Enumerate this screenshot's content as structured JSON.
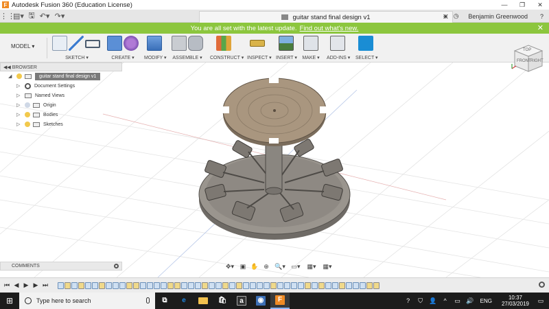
{
  "title_bar": {
    "app_icon": "F",
    "title": "Autodesk Fusion 360 (Education License)",
    "window_controls": [
      "—",
      "❐",
      "✕"
    ]
  },
  "tab_bar": {
    "quick_access": [
      "⋮⋮",
      "▤▾",
      "🖫",
      "↶▾",
      "↷▾"
    ],
    "document_tab": "guitar stand final design v1",
    "close": "✕",
    "right": {
      "new_tab": "+",
      "clock": "◷",
      "user": "Benjamin Greenwood",
      "help": "?"
    }
  },
  "banner": {
    "message": "You are all set with the latest update.",
    "link": "Find out what's new.",
    "close": "✕"
  },
  "toolbar": {
    "workspace": "MODEL ▾",
    "groups": [
      {
        "label": "SKETCH ▾",
        "icons": [
          "sketch-create-icon",
          "line-icon",
          "rectangle-icon"
        ]
      },
      {
        "label": "CREATE ▾",
        "icons": [
          "extrude-icon",
          "form-icon"
        ]
      },
      {
        "label": "MODIFY ▾",
        "icons": [
          "press-pull-icon"
        ]
      },
      {
        "label": "ASSEMBLE ▾",
        "icons": [
          "new-component-icon",
          "joint-icon"
        ]
      },
      {
        "label": "CONSTRUCT ▾",
        "icons": [
          "offset-plane-icon"
        ]
      },
      {
        "label": "INSPECT ▾",
        "icons": [
          "measure-icon"
        ]
      },
      {
        "label": "INSERT ▾",
        "icons": [
          "insert-image-icon"
        ]
      },
      {
        "label": "MAKE ▾",
        "icons": [
          "3d-print-icon"
        ]
      },
      {
        "label": "ADD-INS ▾",
        "icons": [
          "scripts-icon"
        ]
      },
      {
        "label": "SELECT ▾",
        "icons": [
          "select-icon"
        ]
      }
    ]
  },
  "browser": {
    "header": "◀◀  BROWSER",
    "items": [
      {
        "label": "guitar stand final design v1",
        "type": "root"
      },
      {
        "label": "Document Settings",
        "type": "settings"
      },
      {
        "label": "Named Views",
        "type": "folder"
      },
      {
        "label": "Origin",
        "type": "folder-bulb"
      },
      {
        "label": "Bodies",
        "type": "folder-bulb"
      },
      {
        "label": "Sketches",
        "type": "folder-bulb"
      }
    ]
  },
  "comments": {
    "label": "COMMENTS"
  },
  "navbar": [
    "✥▾",
    "▣",
    "✋",
    "⊕",
    "🔍▾",
    "▭▾",
    "▦▾",
    "▦▾"
  ],
  "viewcube": {
    "front": "FRONT",
    "right": "RIGHT",
    "top": "TOP"
  },
  "timeline": {
    "controls": [
      "⏮",
      "◀",
      "▶",
      "▶",
      "⏭"
    ],
    "item_count": 47,
    "settings": "gear-icon"
  },
  "taskbar": {
    "start": "⊞",
    "search_placeholder": "Type here to search",
    "apps": [
      {
        "name": "task-view",
        "glyph": "⧉",
        "color": "#555555"
      },
      {
        "name": "edge",
        "glyph": "e",
        "color": "#1e88e5"
      },
      {
        "name": "file-explorer",
        "glyph": "▬",
        "color": "#f2c14e"
      },
      {
        "name": "store",
        "glyph": "🛍",
        "color": "#2d7fd3"
      },
      {
        "name": "amazon",
        "glyph": "a",
        "color": "#333333"
      },
      {
        "name": "media",
        "glyph": "◉",
        "color": "#3d6fb5"
      },
      {
        "name": "fusion-360",
        "glyph": "F",
        "color": "#f08a24"
      }
    ],
    "tray": {
      "icons": [
        "?",
        "⛉",
        "👤",
        "^",
        "▭",
        "🔊"
      ],
      "language": "ENG",
      "time": "10:37",
      "date": "27/03/2019",
      "notifications": "▭"
    }
  },
  "colors": {
    "banner": "#8cc63e",
    "select_button": "#1a8dd4",
    "model_body": "#8a8680",
    "model_top": "#a9967f"
  }
}
